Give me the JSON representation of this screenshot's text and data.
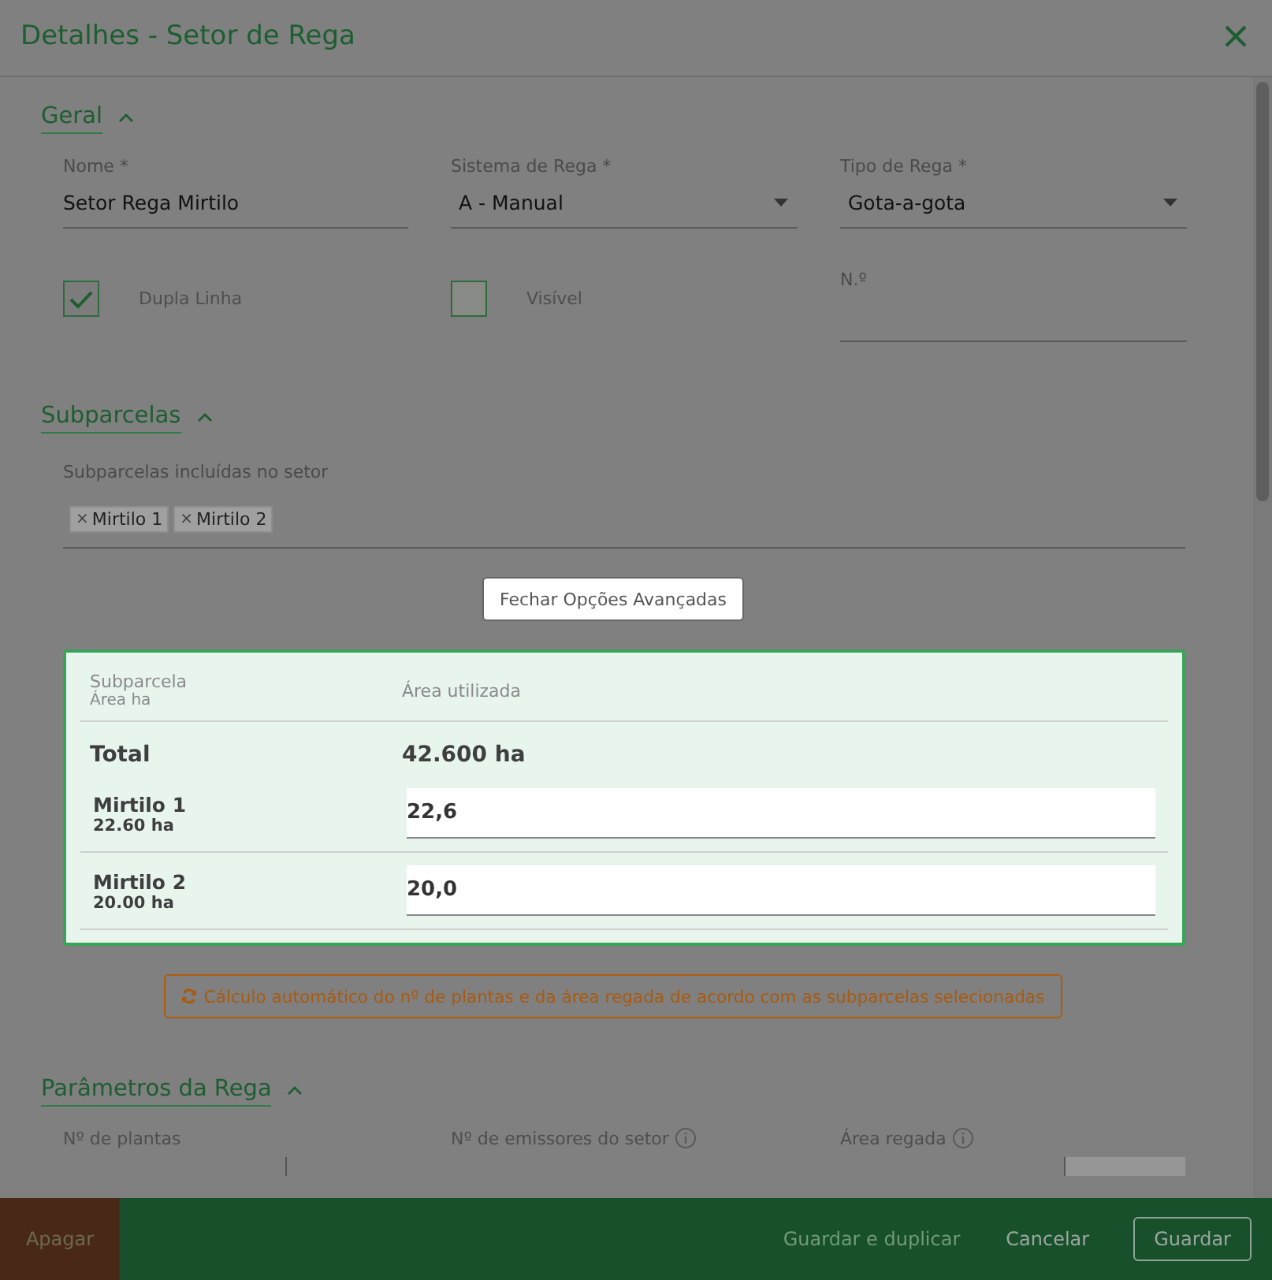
{
  "dialog": {
    "title": "Detalhes - Setor de Rega"
  },
  "general": {
    "title": "Geral",
    "expanded": true,
    "fields": [
      {
        "kind": "text",
        "label": "Nome *",
        "value": "Setor Rega Mirtilo"
      },
      {
        "kind": "select",
        "label": "Sistema de Rega *",
        "value": "A - Manual"
      },
      {
        "kind": "select",
        "label": "Tipo de Rega *",
        "value": "Gota-a-gota"
      }
    ],
    "checkboxes": [
      {
        "label": "Dupla Linha",
        "checked": true
      },
      {
        "label": "Visível",
        "checked": false
      }
    ],
    "number_field": {
      "label": "N.º"
    }
  },
  "subparcels": {
    "title": "Subparcelas",
    "expanded": true,
    "label": "Subparcelas incluídas no setor",
    "tags": [
      {
        "remove": "×",
        "label": "Mirtilo 1"
      },
      {
        "remove": "×",
        "label": "Mirtilo 2"
      }
    ]
  },
  "advanced_button": "Fechar Opções Avançadas",
  "area_table": {
    "column_1": "Subparcela",
    "column_1_sub": "Área ha",
    "column_2": "Área utilizada",
    "total": {
      "label": "Total",
      "value": "42.600 ha"
    },
    "rows": [
      {
        "name": "Mirtilo 1",
        "area": "22.60 ha",
        "value": "22,6"
      },
      {
        "name": "Mirtilo 2",
        "area": "20.00 ha",
        "value": "20,0"
      }
    ]
  },
  "calc_button": "Cálculo automático do nº de plantas e da área regada de acordo com as subparcelas selecionadas",
  "parameters": {
    "title": "Parâmetros da Rega",
    "expanded": true,
    "labels": [
      {
        "label": "Nº de plantas",
        "info": false
      },
      {
        "label": "Nº de emissores do setor",
        "info": true
      },
      {
        "label": "Área regada",
        "info": true
      }
    ]
  },
  "footer": {
    "delete": "Apagar",
    "buttons": [
      {
        "kind": "link",
        "label": "Guardar e duplicar",
        "disabled": true
      },
      {
        "kind": "link",
        "label": "Cancelar",
        "disabled": false
      },
      {
        "kind": "outline",
        "label": "Guardar",
        "disabled": false
      }
    ]
  }
}
